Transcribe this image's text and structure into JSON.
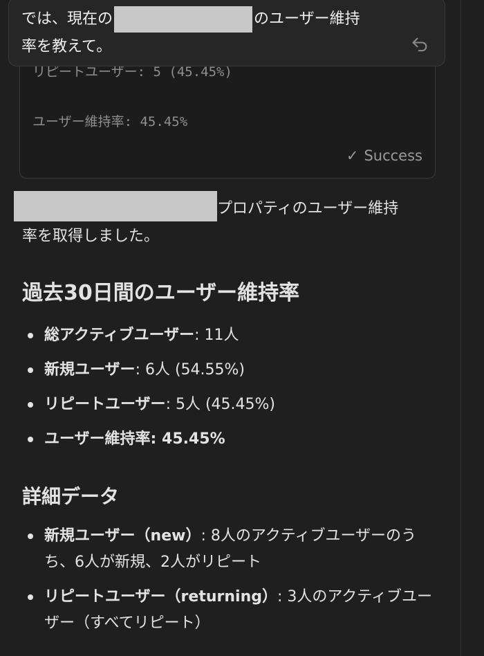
{
  "user_message": {
    "line1_before": "では、現在の",
    "line1_after": "のユーザー維持",
    "line2": "率を教えて。"
  },
  "tool_output": {
    "line_repeat_partial": "リピートユーザー: 5 (45.45%)",
    "line_retention": "ユーザー維持率: 45.45%",
    "status": "Success"
  },
  "response": {
    "intro_after_redaction": "プロパティのユーザー維持",
    "intro_line2": "率を取得しました。",
    "section1_title": "過去30日間のユーザー維持率",
    "stats": [
      {
        "label": "総アクティブユーザー",
        "value": ": 11人"
      },
      {
        "label": "新規ユーザー",
        "value": ": 6人 (54.55%)"
      },
      {
        "label": "リピートユーザー",
        "value": ": 5人 (45.45%)"
      },
      {
        "label": "ユーザー維持率: 45.45%",
        "value": ""
      }
    ],
    "section2_title": "詳細データ",
    "details": [
      {
        "label": "新規ユーザー（new）",
        "value": ": 8人のアクティブユーザーのうち、6人が新規、2人がリピート"
      },
      {
        "label": "リピートユーザー（returning）",
        "value": ": 3人のアクティブユーザー（すべてリピート）"
      }
    ]
  },
  "icons": {
    "undo": "undo-arrow-icon",
    "success_check": "checkmark-icon"
  }
}
